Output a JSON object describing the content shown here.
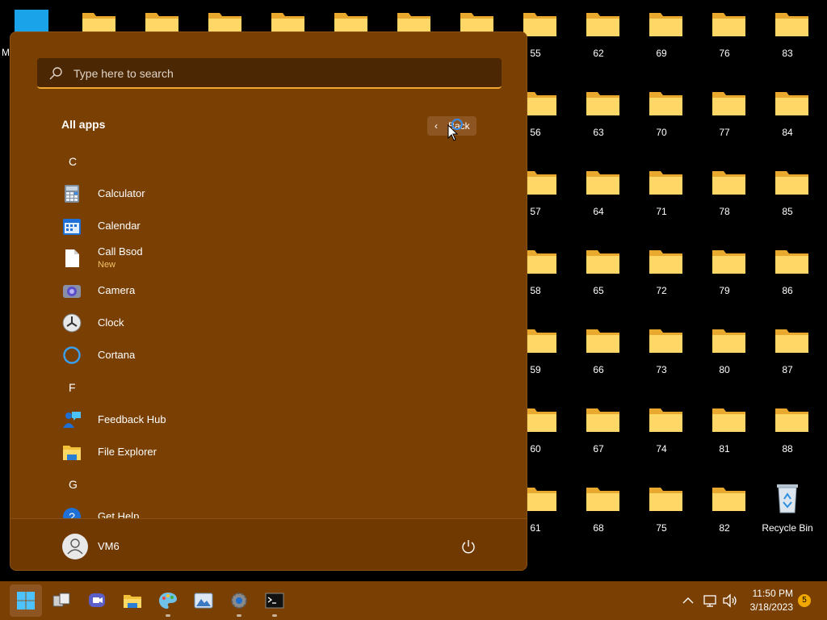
{
  "desktop": {
    "peek_label": "M",
    "folders": [
      "55",
      "56",
      "57",
      "58",
      "59",
      "60",
      "61",
      "62",
      "63",
      "64",
      "65",
      "66",
      "67",
      "68",
      "69",
      "70",
      "71",
      "72",
      "73",
      "74",
      "75",
      "76",
      "77",
      "78",
      "79",
      "80",
      "81",
      "82",
      "83",
      "84",
      "85",
      "86",
      "87",
      "88"
    ],
    "recycle_bin": "Recycle Bin"
  },
  "start": {
    "search_placeholder": "Type here to search",
    "all_apps_title": "All apps",
    "back_label": "Back",
    "groups": [
      {
        "letter": "C",
        "apps": [
          {
            "name": "Calculator",
            "icon": "calculator-icon"
          },
          {
            "name": "Calendar",
            "icon": "calendar-icon"
          },
          {
            "name": "Call Bsod",
            "icon": "file-icon",
            "badge": "New"
          },
          {
            "name": "Camera",
            "icon": "camera-icon"
          },
          {
            "name": "Clock",
            "icon": "clock-icon"
          },
          {
            "name": "Cortana",
            "icon": "cortana-icon"
          }
        ]
      },
      {
        "letter": "F",
        "apps": [
          {
            "name": "Feedback Hub",
            "icon": "feedback-hub-icon"
          },
          {
            "name": "File Explorer",
            "icon": "file-explorer-icon"
          }
        ]
      },
      {
        "letter": "G",
        "apps": [
          {
            "name": "Get Help",
            "icon": "get-help-icon"
          }
        ]
      }
    ],
    "user": "VM6"
  },
  "taskbar": {
    "time": "11:50 PM",
    "date": "3/18/2023",
    "notification_count": "5"
  },
  "colors": {
    "accent": "#7a3f02",
    "search_underline": "#f0a830",
    "badge": "#f0c26a"
  }
}
